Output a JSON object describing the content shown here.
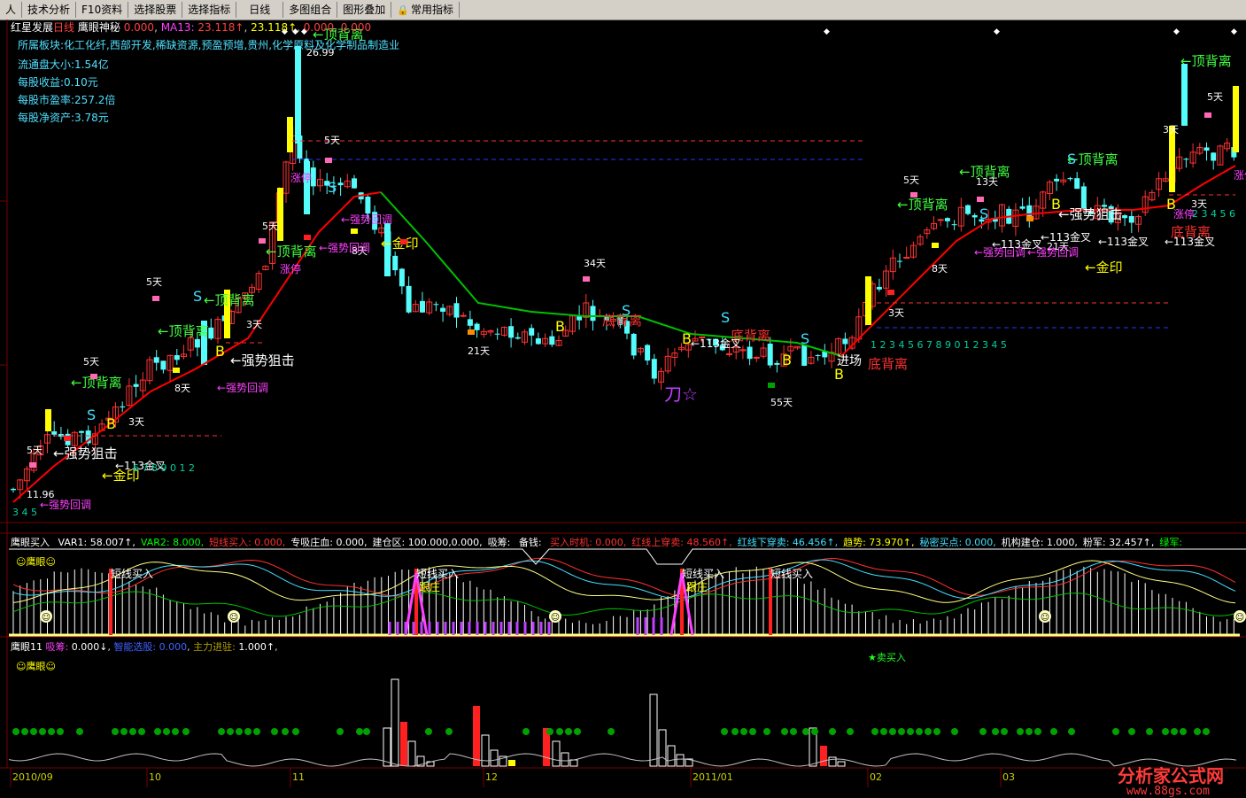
{
  "toolbar": {
    "items": [
      "人",
      "技术分析",
      "F10资料",
      "选择股票",
      "选择指标",
      "日线",
      "多图组合",
      "图形叠加",
      "常用指标"
    ]
  },
  "main_header": {
    "stock": "红星发展",
    "period": "日线",
    "indicator": "鹰眼神秘",
    "v1": "0.000",
    "ma_label": "MA13:",
    "ma_val": "23.118↑",
    "v2": "23.118↑",
    "v3": "0.000",
    "v4": "0.000"
  },
  "info": {
    "sector": "所属板块:化工化纤,西部开发,稀缺资源,预盈预增,贵州,化学原料及化学制品制造业",
    "float_cap": "流通盘大小:1.54亿",
    "eps": "每股收益:0.10元",
    "pe": "每股市盈率:257.2倍",
    "nav": "每股净资产:3.78元"
  },
  "labels": {
    "top_div": "←顶背离",
    "bottom_div": "底背离",
    "strong_resist": "←强势狙击",
    "strong_pullback": "←强势回调",
    "gold_seal": "←金印",
    "cross_113": "←113金叉",
    "zhangting": "涨停",
    "dao": "刀☆",
    "d5": "5天",
    "d3": "3天",
    "d8": "8天",
    "d21": "21天",
    "d34": "34天",
    "d55": "55天",
    "d13": "13天",
    "high_price": "26.99",
    "low_price": "11.96",
    "B": "B",
    "S": "S",
    "seq1": "1 2 3 4 5 6 7 8 9 0 1 2 3 4 5",
    "seq2": "6 7 8 9 0 1 2",
    "seq3": "3 4 5",
    "seq4": "2 3 4 5 6",
    "jincang": "进场"
  },
  "sub1": {
    "title": "鹰眼买入",
    "pairs": [
      {
        "k": "VAR1:",
        "v": "58.007↑",
        "c": "#ffffff"
      },
      {
        "k": "VAR2:",
        "v": "8.000",
        "c": "#00ff00"
      },
      {
        "k": "短线买入:",
        "v": "0.000",
        "c": "#ff3030"
      },
      {
        "k": "专吸庄血:",
        "v": "0.000",
        "c": "#ffffff"
      },
      {
        "k": "建仓区:",
        "v": "100.000,0.000",
        "c": "#ffffff"
      },
      {
        "k": "吸筹:",
        "v": "",
        "c": "#ffffff"
      },
      {
        "k": "备钱:",
        "v": "",
        "c": "#ffffff"
      },
      {
        "k": "买入时机:",
        "v": "0.000",
        "c": "#ff3030"
      },
      {
        "k": "红线上穿卖:",
        "v": "48.560↑",
        "c": "#ff3030"
      },
      {
        "k": "红线下穿卖:",
        "v": "46.456↑",
        "c": "#40e0ff"
      },
      {
        "k": "趋势:",
        "v": "73.970↑",
        "c": "#ffff00"
      },
      {
        "k": "秘密买点:",
        "v": "0.000",
        "c": "#40e0ff"
      },
      {
        "k": "机构建仓:",
        "v": "1.000",
        "c": "#ffffff"
      },
      {
        "k": "粉军:",
        "v": "32.457↑",
        "c": "#ffffff"
      },
      {
        "k": "绿军:",
        "v": "",
        "c": "#00ff00"
      }
    ],
    "logo": "☺鹰眼☺",
    "short_buy": "短线买入",
    "follow": "跟庄"
  },
  "sub2": {
    "title": "鹰眼11",
    "absorb": "吸筹:",
    "absorb_v": "0.000↓",
    "smart": "智能选股:",
    "smart_v": "0.000",
    "main_force": "主力进驻:",
    "main_force_v": "1.000↑",
    "logo": "☺鹰眼☺",
    "buy_signal": "★卖买入"
  },
  "dates": [
    "2010/09",
    "10",
    "11",
    "12",
    "2011/01",
    "02",
    "03"
  ],
  "watermark": {
    "title": "分析家公式网",
    "url": "www.88gs.com"
  },
  "colors": {
    "up": "#ff3232",
    "down": "#54fcfc",
    "ma": "#ff0000",
    "ma2": "#00c000",
    "yellow": "#ffff00",
    "magenta": "#ff40ff",
    "grid": "#7a0000"
  }
}
